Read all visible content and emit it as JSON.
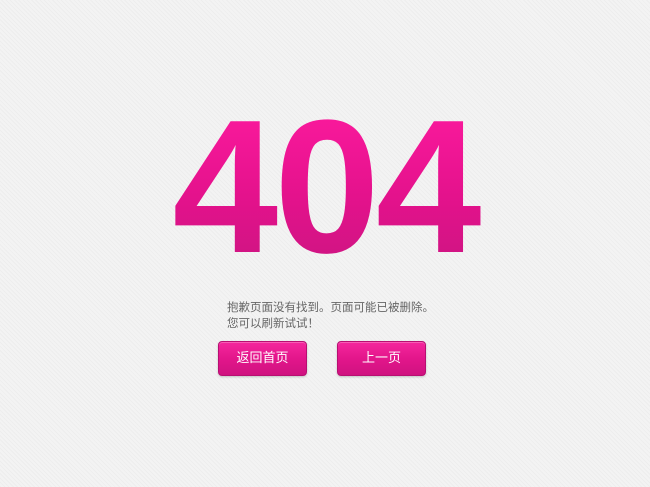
{
  "error": {
    "code": "404",
    "message_line1": "抱歉页面没有找到。页面可能已被删除。",
    "message_line2": "您可以刷新试试！"
  },
  "buttons": {
    "home_label": "返回首页",
    "back_label": "上一页"
  },
  "colors": {
    "accent": "#e4128c",
    "background": "#f3f3f3",
    "text": "#666666"
  }
}
